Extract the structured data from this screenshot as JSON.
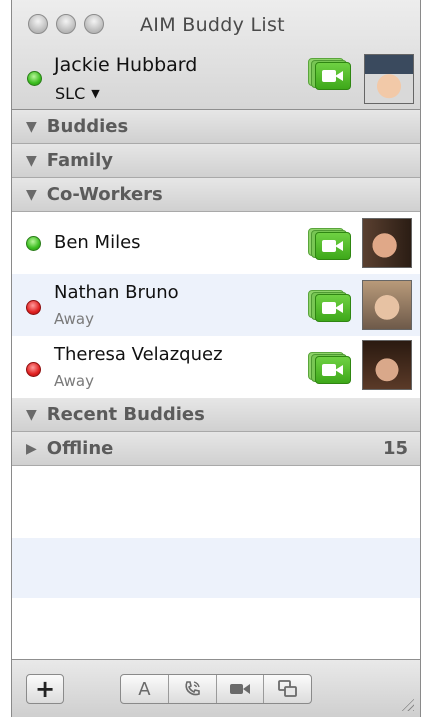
{
  "window": {
    "title": "AIM Buddy List"
  },
  "me": {
    "name": "Jackie Hubbard",
    "location": "SLC",
    "status_color": "#3bbd1f"
  },
  "groups": {
    "buddies": "Buddies",
    "family": "Family",
    "coworkers": "Co-Workers",
    "recent": "Recent Buddies",
    "offline": "Offline",
    "offline_count": "15"
  },
  "buddies": [
    {
      "name": "Ben Miles",
      "status": "",
      "status_color": "#3bbd1f"
    },
    {
      "name": "Nathan Bruno",
      "status": "Away",
      "status_color": "#e02020"
    },
    {
      "name": "Theresa Velazquez",
      "status": "Away",
      "status_color": "#e02020"
    }
  ],
  "toolbar": {
    "add_label": "+",
    "font_label": "A",
    "icons": [
      "add-icon",
      "font-icon",
      "phone-icon",
      "video-icon",
      "screen-share-icon"
    ]
  },
  "colors": {
    "alt_row": "#edf2fb",
    "video_green": "#3ea81a"
  }
}
